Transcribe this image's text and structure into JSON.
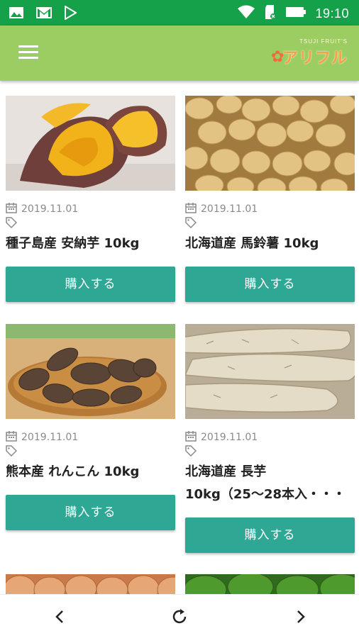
{
  "status_bar": {
    "time": "19:10",
    "icons": [
      "image-icon",
      "gmail-icon",
      "play-store-icon",
      "wifi-icon",
      "sd-card-icon",
      "battery-icon"
    ]
  },
  "app_bar": {
    "logo_sub": "TSUJI FRUIT'S",
    "logo_text": "アリフル"
  },
  "products": [
    {
      "date": "2019.11.01",
      "title": "種子島産 安納芋 10kg",
      "button": "購入する"
    },
    {
      "date": "2019.11.01",
      "title": "北海道産 馬鈴薯 10kg",
      "button": "購入する"
    },
    {
      "date": "2019.11.01",
      "title": "熊本産 れんこん 10kg",
      "button": "購入する"
    },
    {
      "date": "2019.11.01",
      "title_line1": "北海道産 長芋",
      "title_line2": "10kg（25〜28本入・・・",
      "button": "購入する"
    }
  ],
  "colors": {
    "status_bar": "#15a04a",
    "app_bar": "#9ccd62",
    "buy_button": "#2ea894"
  }
}
